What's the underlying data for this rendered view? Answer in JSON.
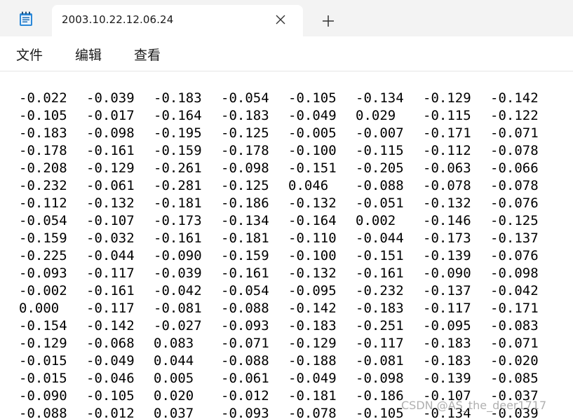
{
  "window": {
    "tab_title": "2003.10.22.12.06.24",
    "app_icon": "notepad-icon",
    "close_icon": "close-icon",
    "new_tab_icon": "plus-icon"
  },
  "menu": {
    "file": "文件",
    "edit": "编辑",
    "view": "查看"
  },
  "document": {
    "rows": [
      [
        "-0.022",
        "-0.039",
        "-0.183",
        "-0.054",
        "-0.105",
        "-0.134",
        "-0.129",
        "-0.142"
      ],
      [
        "-0.105",
        "-0.017",
        "-0.164",
        "-0.183",
        "-0.049",
        "0.029",
        "-0.115",
        "-0.122"
      ],
      [
        "-0.183",
        "-0.098",
        "-0.195",
        "-0.125",
        "-0.005",
        "-0.007",
        "-0.171",
        "-0.071"
      ],
      [
        "-0.178",
        "-0.161",
        "-0.159",
        "-0.178",
        "-0.100",
        "-0.115",
        "-0.112",
        "-0.078"
      ],
      [
        "-0.208",
        "-0.129",
        "-0.261",
        "-0.098",
        "-0.151",
        "-0.205",
        "-0.063",
        "-0.066"
      ],
      [
        "-0.232",
        "-0.061",
        "-0.281",
        "-0.125",
        "0.046",
        "-0.088",
        "-0.078",
        "-0.078"
      ],
      [
        "-0.112",
        "-0.132",
        "-0.181",
        "-0.186",
        "-0.132",
        "-0.051",
        "-0.132",
        "-0.076"
      ],
      [
        "-0.054",
        "-0.107",
        "-0.173",
        "-0.134",
        "-0.164",
        "0.002",
        "-0.146",
        "-0.125"
      ],
      [
        "-0.159",
        "-0.032",
        "-0.161",
        "-0.181",
        "-0.110",
        "-0.044",
        "-0.173",
        "-0.137"
      ],
      [
        "-0.225",
        "-0.044",
        "-0.090",
        "-0.159",
        "-0.100",
        "-0.151",
        "-0.139",
        "-0.076"
      ],
      [
        "-0.093",
        "-0.117",
        "-0.039",
        "-0.161",
        "-0.132",
        "-0.161",
        "-0.090",
        "-0.098"
      ],
      [
        "-0.002",
        "-0.161",
        "-0.042",
        "-0.054",
        "-0.095",
        "-0.232",
        "-0.137",
        "-0.042"
      ],
      [
        "0.000",
        "-0.117",
        "-0.081",
        "-0.088",
        "-0.142",
        "-0.183",
        "-0.117",
        "-0.171"
      ],
      [
        "-0.154",
        "-0.142",
        "-0.027",
        "-0.093",
        "-0.183",
        "-0.251",
        "-0.095",
        "-0.083"
      ],
      [
        "-0.129",
        "-0.068",
        "0.083",
        "-0.071",
        "-0.129",
        "-0.117",
        "-0.183",
        "-0.071"
      ],
      [
        "-0.015",
        "-0.049",
        "0.044",
        "-0.088",
        "-0.188",
        "-0.081",
        "-0.183",
        "-0.020"
      ],
      [
        "-0.015",
        "-0.046",
        "0.005",
        "-0.061",
        "-0.049",
        "-0.098",
        "-0.139",
        "-0.085"
      ],
      [
        "-0.090",
        "-0.105",
        "0.020",
        "-0.012",
        "-0.181",
        "-0.186",
        "-0.107",
        "-0.037"
      ],
      [
        "-0.088",
        "-0.012",
        "0.037",
        "-0.093",
        "-0.078",
        "-0.105",
        "-0.134",
        "-0.039"
      ]
    ]
  },
  "watermark": "CSDN @AS_the_deer1717"
}
